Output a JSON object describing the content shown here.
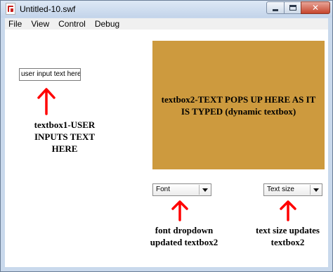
{
  "window": {
    "title": "Untitled-10.swf",
    "close_glyph": "✕"
  },
  "menu": {
    "items": [
      "File",
      "View",
      "Control",
      "Debug"
    ]
  },
  "stage": {
    "textbox1_value": "user input text here",
    "textbox2_text": "textbox2-TEXT POPS UP HERE AS IT IS TYPED (dynamic textbox)",
    "textbox2_color": "#cd9a3e",
    "font_dropdown_value": "Font",
    "size_dropdown_value": "Text size",
    "annotations": {
      "textbox1": "textbox1-USER INPUTS TEXT HERE",
      "font": "font dropdown updated textbox2",
      "size": "text size updates textbox2"
    },
    "arrow_color": "#ff0000"
  },
  "icons": [
    "swf-file-icon",
    "minimize-icon",
    "maximize-icon",
    "close-icon",
    "chevron-down-icon",
    "arrow-up-icon"
  ]
}
